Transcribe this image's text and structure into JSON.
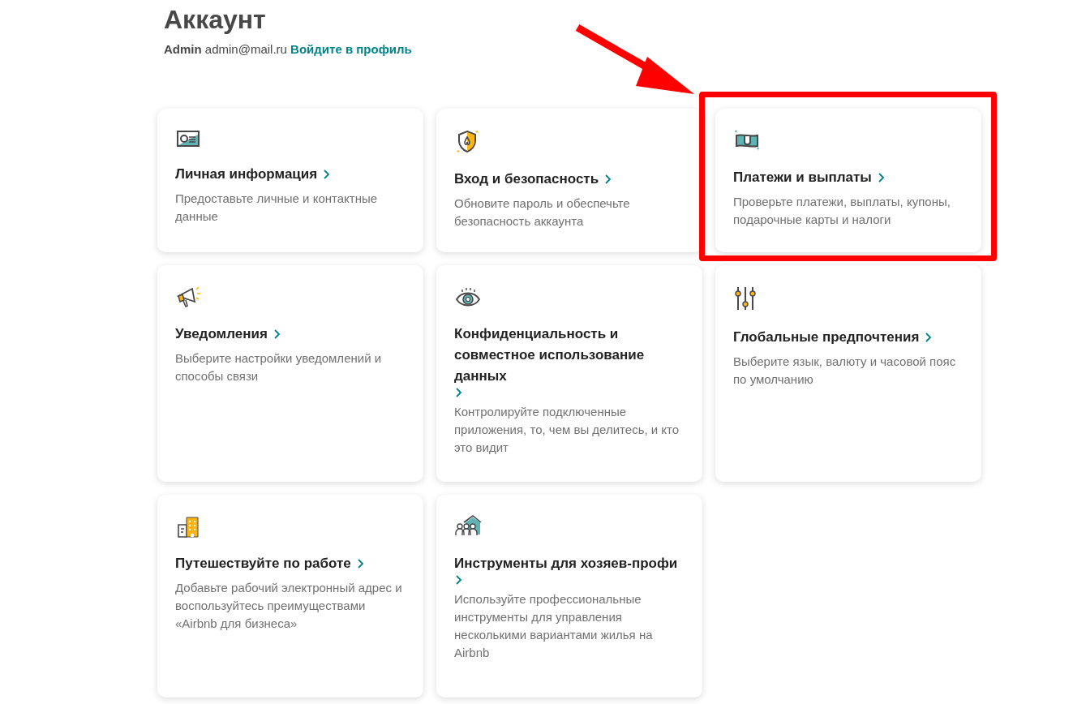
{
  "title": "Аккаунт",
  "user": {
    "text": "**Admin** admin@mail.ru",
    "link": "Войдите в профиль"
  },
  "callout_arrow": true,
  "cards": [
    {
      "title": "Личная информация",
      "description": "Предоставьте личные и контактные данные",
      "highlighted": false
    },
    {
      "title": "Вход и безопасность",
      "description": "Обновите пароль и обеспечьте безопасность аккаунта",
      "highlighted": false
    },
    {
      "title": "Платежи и выплаты",
      "description": "Проверьте платежи, выплаты, купоны, подарочные карты и налоги",
      "highlighted": true
    },
    {
      "title": "Уведомления",
      "description": "Выберите настройки уведомлений и способы связи",
      "highlighted": false
    },
    {
      "title": "Конфиденциальность и совместное использование данных",
      "description": "Контролируйте подключенные приложения, то, чем вы делитесь, и кто это видит",
      "highlighted": false
    },
    {
      "title": "Глобальные предпочтения",
      "description": "Выберите язык, валюту и часовой пояс по умолчанию",
      "highlighted": false
    },
    {
      "title": "Путешествуйте по работе",
      "description": "Добавьте рабочий электронный адрес и воспользуйтесь преимуществами «Airbnb для бизнеса»",
      "highlighted": false
    },
    {
      "title": "Инструменты для хозяев-профи",
      "description": "Используйте профессиональные инструменты для управления несколькими вариантами жилья на Airbnb",
      "highlighted": false
    }
  ]
}
